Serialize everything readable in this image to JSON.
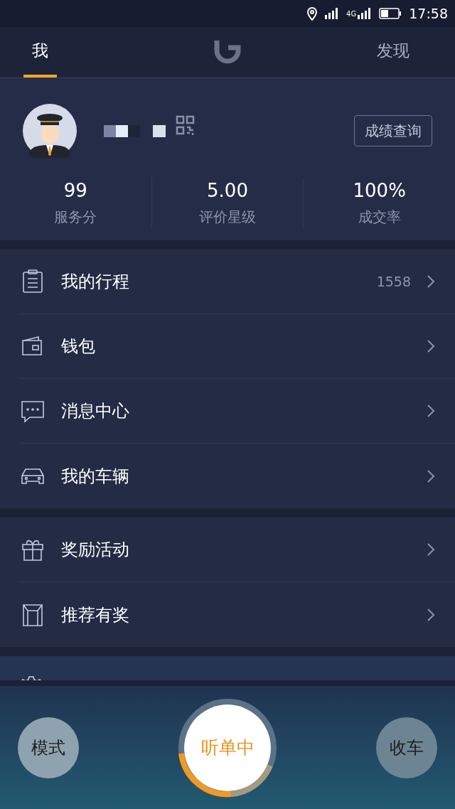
{
  "status_bar": {
    "network": "4G",
    "time": "17:58"
  },
  "tabs": [
    {
      "kind": "text",
      "label": "我",
      "selected": true
    },
    {
      "kind": "logo",
      "selected": false
    },
    {
      "kind": "text",
      "label": "发现",
      "selected": false
    }
  ],
  "profile": {
    "button": "成绩查询",
    "stats": [
      {
        "value": "99",
        "label": "服务分"
      },
      {
        "value": "5.00",
        "label": "评价星级"
      },
      {
        "value": "100%",
        "label": "成交率"
      }
    ]
  },
  "menu_groups": [
    [
      {
        "label": "我的行程",
        "count": "1558"
      },
      {
        "label": "钱包"
      },
      {
        "label": "消息中心"
      },
      {
        "label": "我的车辆"
      }
    ],
    [
      {
        "label": "奖励活动"
      },
      {
        "label": "推荐有奖"
      }
    ]
  ],
  "bottom_bar": {
    "left": "模式",
    "center": "听单中",
    "right": "收车"
  }
}
